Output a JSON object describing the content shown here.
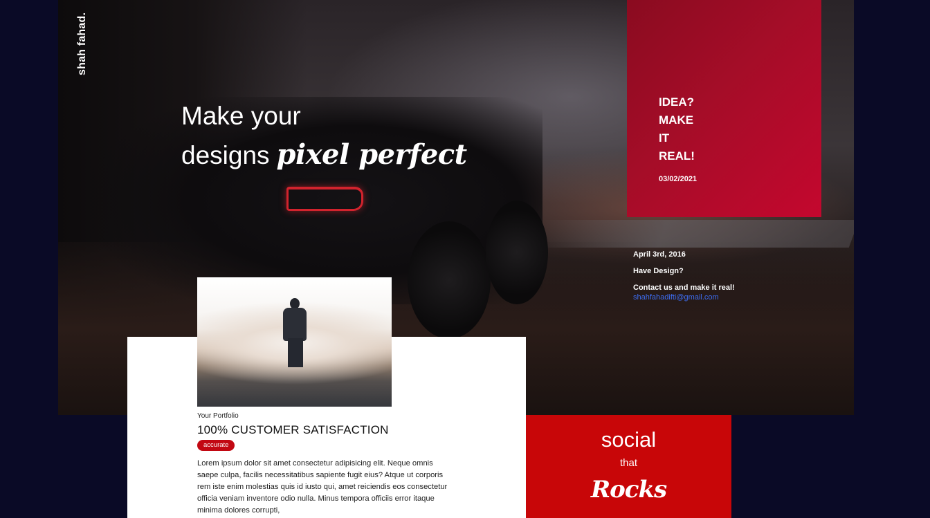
{
  "brand": {
    "name": "shah fahad."
  },
  "hero": {
    "headline_line1": "Make your",
    "headline_line2": "designs",
    "headline_script": "pixel perfect"
  },
  "idea_card": {
    "lines": [
      "IDEA?",
      "MAKE",
      "IT",
      "REAL!"
    ],
    "date": "03/02/2021"
  },
  "contact": {
    "date": "April 3rd, 2016",
    "question": "Have Design?",
    "cta": "Contact us and make it real!",
    "email": "shahfahadifti@gmail.com"
  },
  "portfolio": {
    "label": "Your Portfolio",
    "title": "100% CUSTOMER SATISFACTION",
    "badge": "accurate",
    "body": "Lorem ipsum dolor sit amet consectetur adipisicing elit. Neque omnis saepe culpa, facilis necessitatibus sapiente fugit eius? Atque ut corporis rem iste enim molestias quis id iusto qui, amet reiciendis eos consectetur officia veniam inventore odio nulla. Minus tempora officiis error itaque minima dolores corrupti,"
  },
  "social_card": {
    "line1": "social",
    "line2": "that",
    "line3": "Rocks"
  },
  "colors": {
    "page_bg": "#0a0a26",
    "accent_red": "#c80608",
    "card_crimson": "#a50d28",
    "link_blue": "#3d6cf0"
  }
}
